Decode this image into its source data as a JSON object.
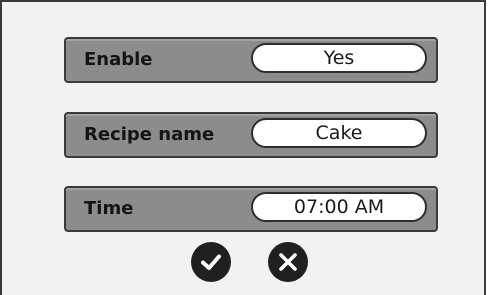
{
  "settings": {
    "rows": [
      {
        "label": "Enable",
        "value": "Yes"
      },
      {
        "label": "Recipe name",
        "value": "Cake"
      },
      {
        "label": "Time",
        "value": "07:00 AM"
      }
    ]
  },
  "actions": {
    "confirm_icon": "checkmark-icon",
    "cancel_icon": "close-icon"
  },
  "colors": {
    "row_bg": "#8c8c8c",
    "panel_bg": "#f2f2f2",
    "field_bg": "#ffffff",
    "button_bg": "#202020"
  }
}
